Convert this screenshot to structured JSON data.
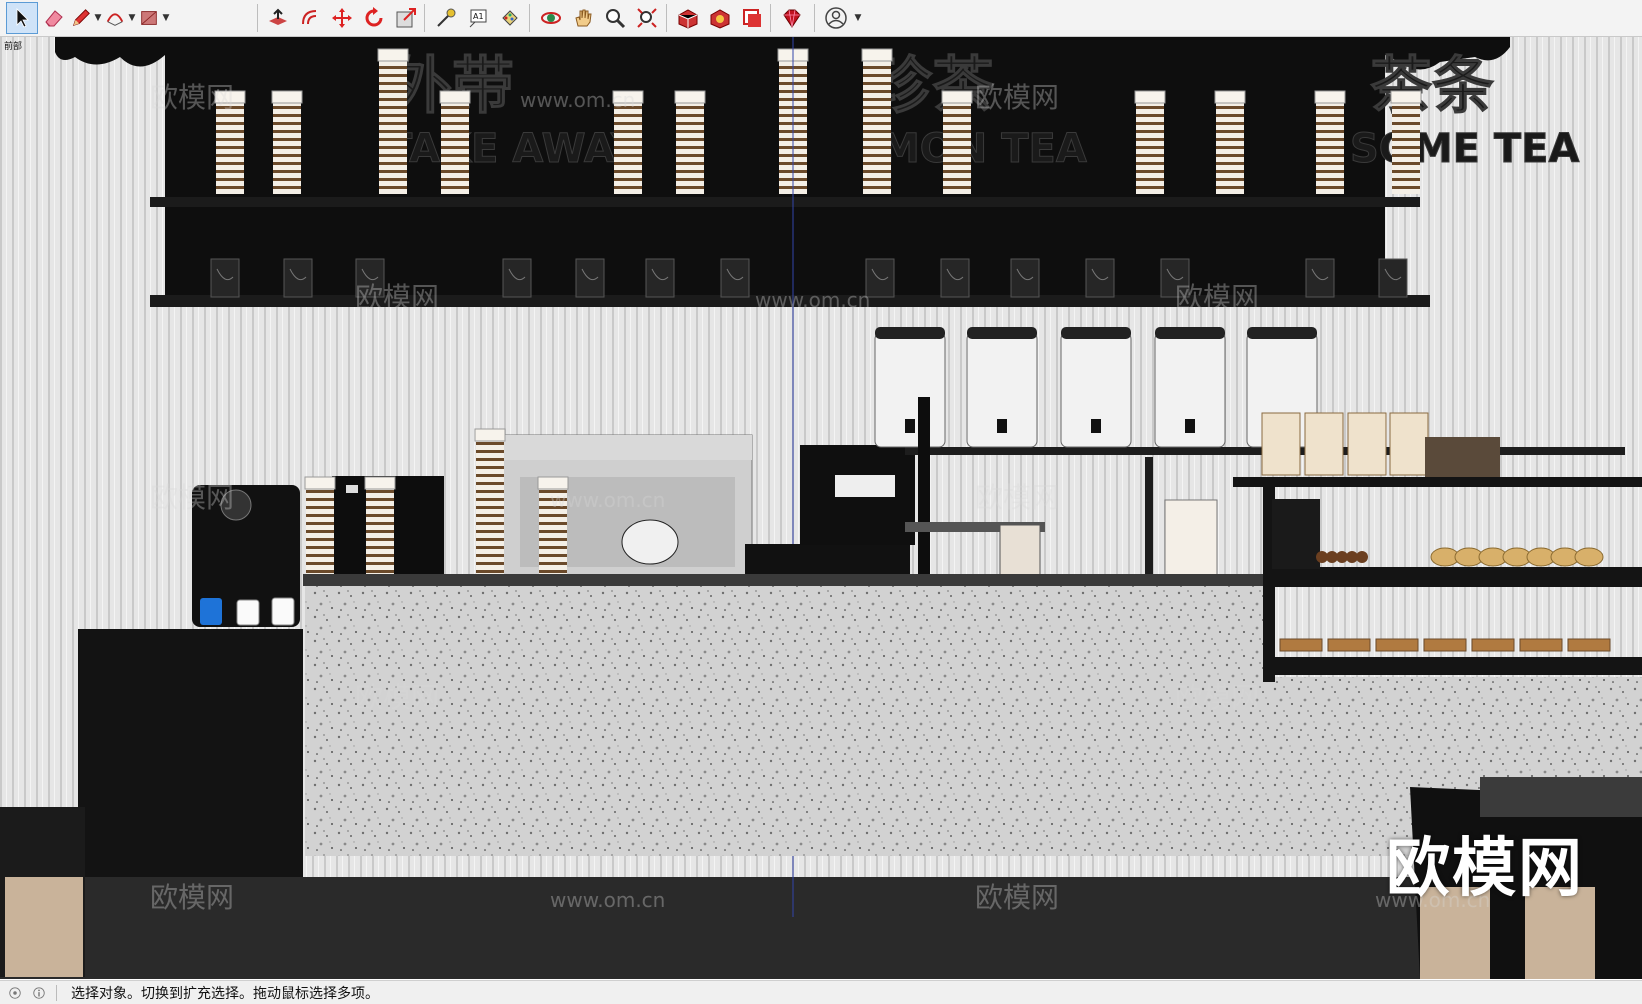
{
  "toolbar": {
    "tools": [
      {
        "name": "select-tool",
        "icon": "arrow-cursor-icon",
        "active": true
      },
      {
        "name": "eraser-tool",
        "icon": "eraser-icon"
      },
      {
        "name": "line-tool",
        "icon": "pencil-icon",
        "dropdown": true
      },
      {
        "name": "arc-tool",
        "icon": "arc-icon",
        "dropdown": true
      },
      {
        "name": "shape-tool",
        "icon": "rectangle-icon",
        "dropdown": true
      },
      {
        "name": "push-pull-tool",
        "icon": "push-pull-icon"
      },
      {
        "name": "offset-tool",
        "icon": "offset-icon"
      },
      {
        "name": "move-tool",
        "icon": "move-icon"
      },
      {
        "name": "rotate-tool",
        "icon": "rotate-icon"
      },
      {
        "name": "scale-tool",
        "icon": "scale-icon"
      },
      {
        "name": "tape-measure-tool",
        "icon": "tape-measure-icon"
      },
      {
        "name": "text-tool",
        "icon": "text-icon"
      },
      {
        "name": "paint-bucket-tool",
        "icon": "paint-bucket-icon"
      },
      {
        "name": "orbit-tool",
        "icon": "orbit-icon"
      },
      {
        "name": "pan-tool",
        "icon": "hand-icon"
      },
      {
        "name": "zoom-tool",
        "icon": "magnifier-icon"
      },
      {
        "name": "zoom-extents-tool",
        "icon": "zoom-extents-icon"
      },
      {
        "name": "3d-warehouse-button",
        "icon": "warehouse-icon"
      },
      {
        "name": "extension-warehouse-button",
        "icon": "extension-icon"
      },
      {
        "name": "layout-button",
        "icon": "layout-icon"
      },
      {
        "name": "ruby-console-button",
        "icon": "ruby-icon"
      },
      {
        "name": "account-button",
        "icon": "user-icon",
        "dropdown": true
      }
    ]
  },
  "scene": {
    "tab_label": "前部",
    "signs": [
      {
        "cn": "外带",
        "en": "TAKE AWAY"
      },
      {
        "cn": "珍茶",
        "en": "MON TEA"
      },
      {
        "cn": "茶条",
        "en": "SOME TEA"
      }
    ],
    "watermark_text": "欧模网",
    "watermark_url": "www.om.cn"
  },
  "statusbar": {
    "message": "选择对象。切换到扩充选择。拖动鼠标选择多项。"
  },
  "colors": {
    "toolbar_bg": "#f3f3f3",
    "active_tool": "#cfe3f8",
    "wall": "#e4e4e4",
    "counter_black": "#151515",
    "terrazzo": "#cfcfcf"
  }
}
